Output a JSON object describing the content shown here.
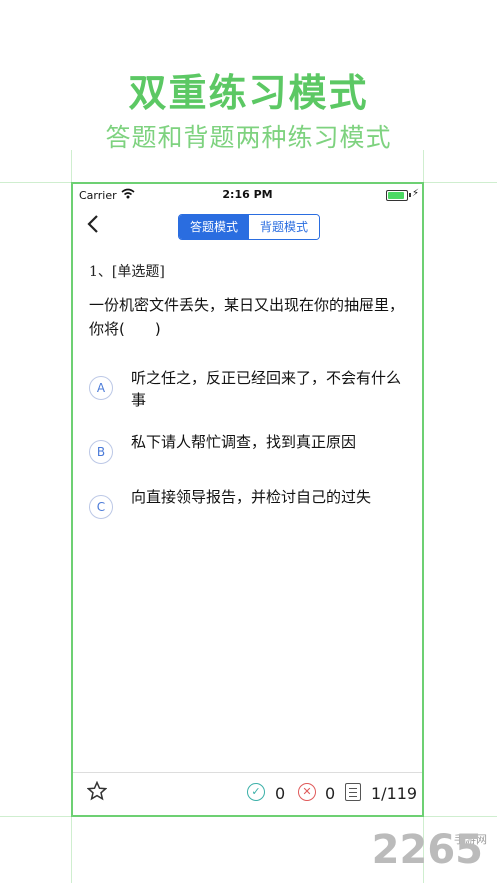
{
  "promo": {
    "title": "双重练习模式",
    "subtitle": "答题和背题两种练习模式"
  },
  "status_bar": {
    "carrier": "Carrier",
    "time": "2:16 PM"
  },
  "navbar": {
    "back_icon": "chevron-left",
    "modes": [
      "答题模式",
      "背题模式"
    ],
    "active_mode": "答题模式"
  },
  "question": {
    "number_type": "1、[单选题]",
    "text": "一份机密文件丢失，某日又出现在你的抽屉里，你将(　　)",
    "options": [
      {
        "letter": "A",
        "text": "听之任之，反正已经回来了，不会有什么事"
      },
      {
        "letter": "B",
        "text": "私下请人帮忙调查，找到真正原因"
      },
      {
        "letter": "C",
        "text": "向直接领导报告，并检讨自己的过失"
      }
    ]
  },
  "bottom_bar": {
    "star_icon": "star-outline",
    "correct_count": "0",
    "wrong_count": "0",
    "progress": "1/119"
  },
  "watermark": {
    "text": "2265",
    "site": "手游网"
  },
  "colors": {
    "promo_green": "#5cc864",
    "accent_blue": "#2a6de0",
    "correct_teal": "#3bb0a8",
    "wrong_red": "#e05a5a",
    "frame_green": "#6dd073"
  }
}
